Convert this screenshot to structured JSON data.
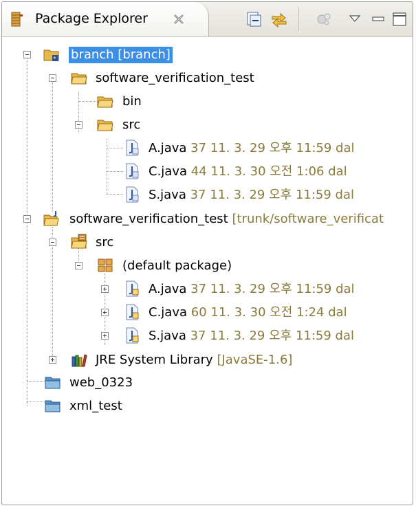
{
  "view": {
    "title": "Package Explorer"
  },
  "tree": [
    {
      "id": "n0",
      "label": "branch [branch]",
      "decoration": "",
      "selected": true,
      "icon": "svn-project-icon"
    },
    {
      "id": "n1",
      "label": "software_verification_test",
      "decoration": "",
      "icon": "folder-icon"
    },
    {
      "id": "n2",
      "label": "bin",
      "decoration": "",
      "icon": "folder-icon"
    },
    {
      "id": "n3",
      "label": "src",
      "decoration": "",
      "icon": "folder-icon"
    },
    {
      "id": "n4",
      "label": "A.java",
      "decoration": "37  11. 3. 29 오후 11:59  dal",
      "icon": "java-file-icon"
    },
    {
      "id": "n5",
      "label": "C.java",
      "decoration": "44  11. 3. 30 오전 1:06  dal",
      "icon": "java-file-icon"
    },
    {
      "id": "n6",
      "label": "S.java",
      "decoration": "37  11. 3. 29 오후 11:59  dal",
      "icon": "java-file-icon"
    },
    {
      "id": "n7",
      "label": "software_verification_test",
      "decoration": "[trunk/software_verificat",
      "icon": "java-project-icon"
    },
    {
      "id": "n8",
      "label": "src",
      "decoration": "",
      "icon": "source-folder-icon"
    },
    {
      "id": "n9",
      "label": "(default package)",
      "decoration": "",
      "icon": "package-icon"
    },
    {
      "id": "n10",
      "label": "A.java",
      "decoration": "37  11. 3. 29 오후 11:59  dal",
      "icon": "java-file-icon"
    },
    {
      "id": "n11",
      "label": "C.java",
      "decoration": "60  11. 3. 30 오전 1:24  dal",
      "icon": "java-file-icon"
    },
    {
      "id": "n12",
      "label": "S.java",
      "decoration": "37  11. 3. 29 오후 11:59  dal",
      "icon": "java-file-icon"
    },
    {
      "id": "n13",
      "label": "JRE System Library",
      "decoration": "[JavaSE-1.6]",
      "icon": "library-icon"
    },
    {
      "id": "n14",
      "label": "web_0323",
      "decoration": "",
      "icon": "project-folder-icon"
    },
    {
      "id": "n15",
      "label": "xml_test",
      "decoration": "",
      "icon": "project-folder-icon"
    }
  ],
  "colors": {
    "selection": "#3d8ee6",
    "decoration": "#8b7a3a",
    "folder": "#e8b84a"
  }
}
